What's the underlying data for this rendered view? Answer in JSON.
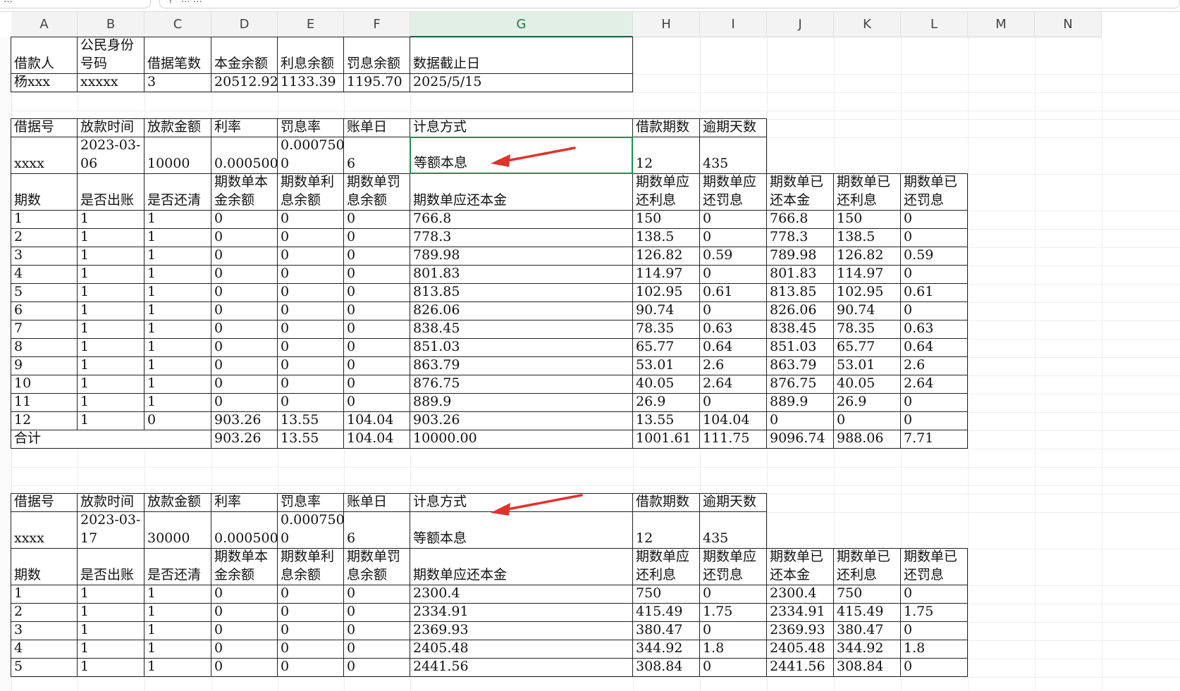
{
  "toolbar": {
    "tab1_label": "…",
    "tab2_label": "… …",
    "search_icon": "search-icon"
  },
  "columns": [
    "A",
    "B",
    "C",
    "D",
    "E",
    "F",
    "G",
    "H",
    "I",
    "J",
    "K",
    "L",
    "M",
    "N"
  ],
  "selected_column": "G",
  "colors": {
    "grid_border": "#222222",
    "selection": "#1e8f4e",
    "arrow": "#e0322e"
  },
  "summary": {
    "headers": [
      "借款人",
      "公民身份\n号码",
      "借据笔数",
      "本金余额",
      "利息余额",
      "罚息余额",
      "数据截止日"
    ],
    "values": [
      "杨xxx",
      "xxxxx",
      "3",
      "20512.92",
      "1133.39",
      "1195.70",
      "2025/5/15"
    ]
  },
  "loans": [
    {
      "info_headers": [
        "借据号",
        "放款时间",
        "放款金额",
        "利率",
        "罚息率",
        "账单日",
        "计息方式",
        "借款期数",
        "逾期天数"
      ],
      "info_values": [
        "xxxx",
        "2023-03-\n06",
        "10000",
        "0.000500",
        "0.000750\n0",
        "6",
        "等额本息",
        "12",
        "435"
      ],
      "period_headers": [
        "期数",
        "是否出账",
        "是否还清",
        "期数单本\n金余额",
        "期数单利\n息余额",
        "期数单罚\n息余额",
        "期数单应还本金",
        "期数单应\n还利息",
        "期数单应\n还罚息",
        "期数单已\n还本金",
        "期数单已\n还利息",
        "期数单已\n还罚息"
      ],
      "rows": [
        [
          "1",
          "1",
          "1",
          "0",
          "0",
          "0",
          "766.8",
          "150",
          "0",
          "766.8",
          "150",
          "0"
        ],
        [
          "2",
          "1",
          "1",
          "0",
          "0",
          "0",
          "778.3",
          "138.5",
          "0",
          "778.3",
          "138.5",
          "0"
        ],
        [
          "3",
          "1",
          "1",
          "0",
          "0",
          "0",
          "789.98",
          "126.82",
          "0.59",
          "789.98",
          "126.82",
          "0.59"
        ],
        [
          "4",
          "1",
          "1",
          "0",
          "0",
          "0",
          "801.83",
          "114.97",
          "0",
          "801.83",
          "114.97",
          "0"
        ],
        [
          "5",
          "1",
          "1",
          "0",
          "0",
          "0",
          "813.85",
          "102.95",
          "0.61",
          "813.85",
          "102.95",
          "0.61"
        ],
        [
          "6",
          "1",
          "1",
          "0",
          "0",
          "0",
          "826.06",
          "90.74",
          "0",
          "826.06",
          "90.74",
          "0"
        ],
        [
          "7",
          "1",
          "1",
          "0",
          "0",
          "0",
          "838.45",
          "78.35",
          "0.63",
          "838.45",
          "78.35",
          "0.63"
        ],
        [
          "8",
          "1",
          "1",
          "0",
          "0",
          "0",
          "851.03",
          "65.77",
          "0.64",
          "851.03",
          "65.77",
          "0.64"
        ],
        [
          "9",
          "1",
          "1",
          "0",
          "0",
          "0",
          "863.79",
          "53.01",
          "2.6",
          "863.79",
          "53.01",
          "2.6"
        ],
        [
          "10",
          "1",
          "1",
          "0",
          "0",
          "0",
          "876.75",
          "40.05",
          "2.64",
          "876.75",
          "40.05",
          "2.64"
        ],
        [
          "11",
          "1",
          "1",
          "0",
          "0",
          "0",
          "889.9",
          "26.9",
          "0",
          "889.9",
          "26.9",
          "0"
        ],
        [
          "12",
          "1",
          "0",
          "903.26",
          "13.55",
          "104.04",
          "903.26",
          "13.55",
          "104.04",
          "0",
          "0",
          "0"
        ]
      ],
      "total": {
        "label": "合计",
        "values": [
          "903.26",
          "13.55",
          "104.04",
          "10000.00",
          "1001.61",
          "111.75",
          "9096.74",
          "988.06",
          "7.71"
        ]
      }
    },
    {
      "info_headers": [
        "借据号",
        "放款时间",
        "放款金额",
        "利率",
        "罚息率",
        "账单日",
        "计息方式",
        "借款期数",
        "逾期天数"
      ],
      "info_values": [
        "xxxx",
        "2023-03-\n17",
        "30000",
        "0.000500",
        "0.000750\n0",
        "6",
        "等额本息",
        "12",
        "435"
      ],
      "period_headers": [
        "期数",
        "是否出账",
        "是否还清",
        "期数单本\n金余额",
        "期数单利\n息余额",
        "期数单罚\n息余额",
        "期数单应还本金",
        "期数单应\n还利息",
        "期数单应\n还罚息",
        "期数单已\n还本金",
        "期数单已\n还利息",
        "期数单已\n还罚息"
      ],
      "rows": [
        [
          "1",
          "1",
          "1",
          "0",
          "0",
          "0",
          "2300.4",
          "750",
          "0",
          "2300.4",
          "750",
          "0"
        ],
        [
          "2",
          "1",
          "1",
          "0",
          "0",
          "0",
          "2334.91",
          "415.49",
          "1.75",
          "2334.91",
          "415.49",
          "1.75"
        ],
        [
          "3",
          "1",
          "1",
          "0",
          "0",
          "0",
          "2369.93",
          "380.47",
          "0",
          "2369.93",
          "380.47",
          "0"
        ],
        [
          "4",
          "1",
          "1",
          "0",
          "0",
          "0",
          "2405.48",
          "344.92",
          "1.8",
          "2405.48",
          "344.92",
          "1.8"
        ],
        [
          "5",
          "1",
          "1",
          "0",
          "0",
          "0",
          "2441.56",
          "308.84",
          "0",
          "2441.56",
          "308.84",
          "0"
        ]
      ]
    }
  ]
}
